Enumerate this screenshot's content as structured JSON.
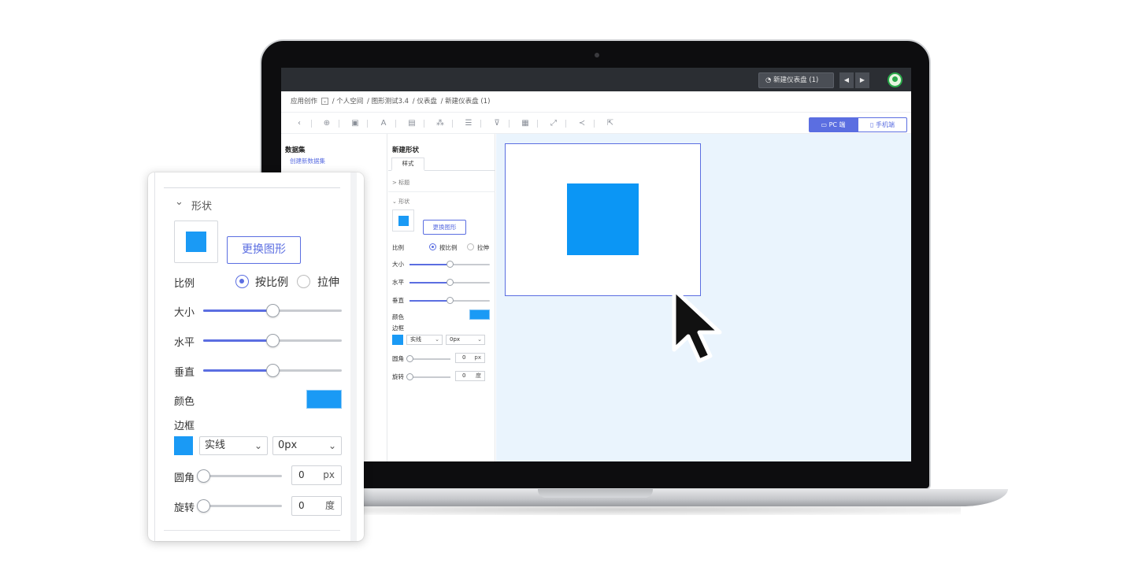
{
  "topbar": {
    "dashboard_button": "新建仪表盘 (1)",
    "prev_label": "◀",
    "next_label": "▶"
  },
  "breadcrumb": {
    "items": [
      "应用创作",
      "/ 个人空间",
      "/ 图形测试3.4",
      "/ 仪表盘",
      "/ 新建仪表盘 (1)"
    ]
  },
  "toolbar": {
    "icons": [
      "back-icon",
      "zoom-icon",
      "image-icon",
      "text-icon",
      "table-icon",
      "component-icon",
      "list-icon",
      "filter-icon",
      "layout-icon",
      "resize-icon",
      "share-icon",
      "export-icon"
    ],
    "pc_label": "PC 端",
    "mobile_label": "手机端"
  },
  "dataset_panel": {
    "title": "数据集",
    "create_link": "创建新数据集"
  },
  "style_panel": {
    "title": "新建形状",
    "tab": "样式",
    "section_title": "标题",
    "section_shape": "形状",
    "change_shape_button": "更换图形",
    "ratio_label": "比例",
    "ratio_option_proportional": "按比例",
    "ratio_option_stretch": "拉伸",
    "size_label": "大小",
    "horizontal_label": "水平",
    "vertical_label": "垂直",
    "color_label": "颜色",
    "border_label": "边框",
    "border_style": "实线",
    "border_width": "0px",
    "corner_label": "圆角",
    "corner_value": "0",
    "corner_unit": "px",
    "rotate_label": "旋转",
    "rotate_value": "0",
    "rotate_unit": "度",
    "size_level": 0.5,
    "horizontal_level": 0.5,
    "vertical_level": 0.5,
    "corner_level": 0,
    "rotate_level": 0
  },
  "zoom_panel": {
    "section_shape": "形状",
    "change_shape_button": "更换图形",
    "ratio_label": "比例",
    "ratio_option_proportional": "按比例",
    "ratio_option_stretch": "拉伸",
    "size_label": "大小",
    "horizontal_label": "水平",
    "vertical_label": "垂直",
    "color_label": "颜色",
    "border_label": "边框",
    "border_style": "实线",
    "border_width": "0px",
    "corner_label": "圆角",
    "corner_value": "0",
    "corner_unit": "px",
    "rotate_label": "旋转",
    "rotate_value": "0",
    "rotate_unit": "度"
  },
  "colors": {
    "accent": "#5b6ee1",
    "shape_fill": "#0b96f5",
    "canvas_bg": "#eaf4fd",
    "topbar_bg": "#2b2e33"
  }
}
